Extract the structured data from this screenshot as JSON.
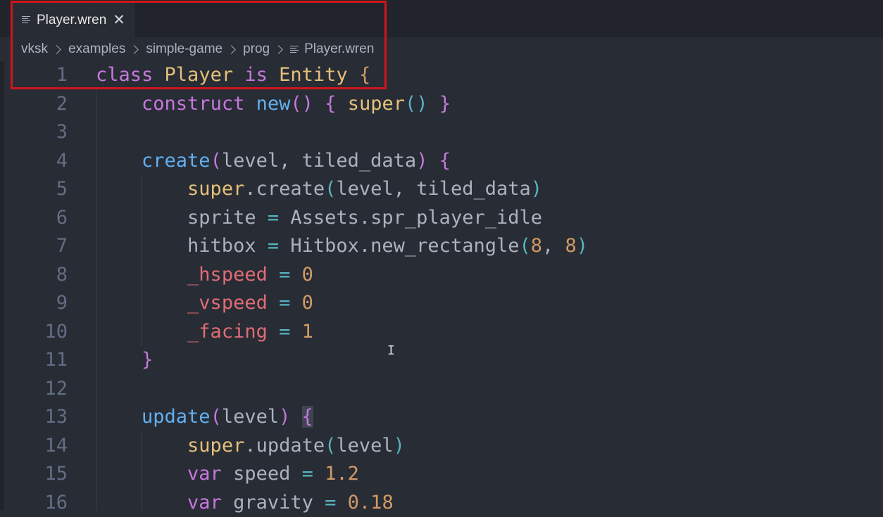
{
  "tab": {
    "label": "Player.wren",
    "close": "✕",
    "icon": "file-lines-icon"
  },
  "breadcrumb": [
    "vksk",
    "examples",
    "simple-game",
    "prog",
    "Player.wren"
  ],
  "cursor_glyph": "I",
  "colors": {
    "keyword": "#c678dd",
    "class": "#e5c07b",
    "function": "#61afef",
    "field": "#e06c75",
    "number": "#d19a66",
    "operator": "#56b6c2",
    "text": "#abb2bf",
    "highlight_box": "#d0151b"
  },
  "lines": [
    {
      "n": "1",
      "tokens": [
        [
          "kw",
          "class"
        ],
        [
          "",
          " "
        ],
        [
          "cls",
          "Player"
        ],
        [
          "",
          " "
        ],
        [
          "kw",
          "is"
        ],
        [
          "",
          " "
        ],
        [
          "cls",
          "Entity"
        ],
        [
          "",
          " "
        ],
        [
          "p1",
          "{"
        ]
      ]
    },
    {
      "n": "2",
      "tokens": [
        [
          "",
          "    "
        ],
        [
          "kw",
          "construct"
        ],
        [
          "",
          " "
        ],
        [
          "fn",
          "new"
        ],
        [
          "p2",
          "()"
        ],
        [
          "",
          " "
        ],
        [
          "p2",
          "{"
        ],
        [
          "",
          " "
        ],
        [
          "cls",
          "super"
        ],
        [
          "op",
          "()"
        ],
        [
          "",
          " "
        ],
        [
          "p2",
          "}"
        ]
      ]
    },
    {
      "n": "3",
      "tokens": []
    },
    {
      "n": "4",
      "tokens": [
        [
          "",
          "    "
        ],
        [
          "fn",
          "create"
        ],
        [
          "p2",
          "("
        ],
        [
          "",
          "level, tiled_data"
        ],
        [
          "p2",
          ")"
        ],
        [
          "",
          " "
        ],
        [
          "p2",
          "{"
        ]
      ]
    },
    {
      "n": "5",
      "tokens": [
        [
          "",
          "        "
        ],
        [
          "cls",
          "super"
        ],
        [
          "",
          ".create"
        ],
        [
          "op",
          "("
        ],
        [
          "",
          "level, tiled_data"
        ],
        [
          "op",
          ")"
        ]
      ]
    },
    {
      "n": "6",
      "tokens": [
        [
          "",
          "        sprite "
        ],
        [
          "op",
          "="
        ],
        [
          "",
          " Assets.spr_player_idle"
        ]
      ]
    },
    {
      "n": "7",
      "tokens": [
        [
          "",
          "        hitbox "
        ],
        [
          "op",
          "="
        ],
        [
          "",
          " Hitbox.new_rectangle"
        ],
        [
          "op",
          "("
        ],
        [
          "num",
          "8"
        ],
        [
          "",
          ", "
        ],
        [
          "num",
          "8"
        ],
        [
          "op",
          ")"
        ]
      ]
    },
    {
      "n": "8",
      "tokens": [
        [
          "",
          "        "
        ],
        [
          "var",
          "_hspeed"
        ],
        [
          "",
          " "
        ],
        [
          "op",
          "="
        ],
        [
          "",
          " "
        ],
        [
          "num",
          "0"
        ]
      ]
    },
    {
      "n": "9",
      "tokens": [
        [
          "",
          "        "
        ],
        [
          "var",
          "_vspeed"
        ],
        [
          "",
          " "
        ],
        [
          "op",
          "="
        ],
        [
          "",
          " "
        ],
        [
          "num",
          "0"
        ]
      ]
    },
    {
      "n": "10",
      "tokens": [
        [
          "",
          "        "
        ],
        [
          "var",
          "_facing"
        ],
        [
          "",
          " "
        ],
        [
          "op",
          "="
        ],
        [
          "",
          " "
        ],
        [
          "num",
          "1"
        ]
      ]
    },
    {
      "n": "11",
      "tokens": [
        [
          "",
          "    "
        ],
        [
          "p2",
          "}"
        ]
      ]
    },
    {
      "n": "12",
      "tokens": []
    },
    {
      "n": "13",
      "tokens": [
        [
          "",
          "    "
        ],
        [
          "fn",
          "update"
        ],
        [
          "p2",
          "("
        ],
        [
          "",
          "level"
        ],
        [
          "p2",
          ")"
        ],
        [
          "",
          " "
        ],
        [
          "p2 bracket-match",
          "{"
        ]
      ]
    },
    {
      "n": "14",
      "tokens": [
        [
          "",
          "        "
        ],
        [
          "cls",
          "super"
        ],
        [
          "",
          ".update"
        ],
        [
          "op",
          "("
        ],
        [
          "",
          "level"
        ],
        [
          "op",
          ")"
        ]
      ]
    },
    {
      "n": "15",
      "tokens": [
        [
          "",
          "        "
        ],
        [
          "kw",
          "var"
        ],
        [
          "",
          " speed "
        ],
        [
          "op",
          "="
        ],
        [
          "",
          " "
        ],
        [
          "num",
          "1.2"
        ]
      ]
    },
    {
      "n": "16",
      "tokens": [
        [
          "",
          "        "
        ],
        [
          "kw",
          "var"
        ],
        [
          "",
          " gravity "
        ],
        [
          "op",
          "="
        ],
        [
          "",
          " "
        ],
        [
          "num",
          "0.18"
        ]
      ]
    }
  ]
}
